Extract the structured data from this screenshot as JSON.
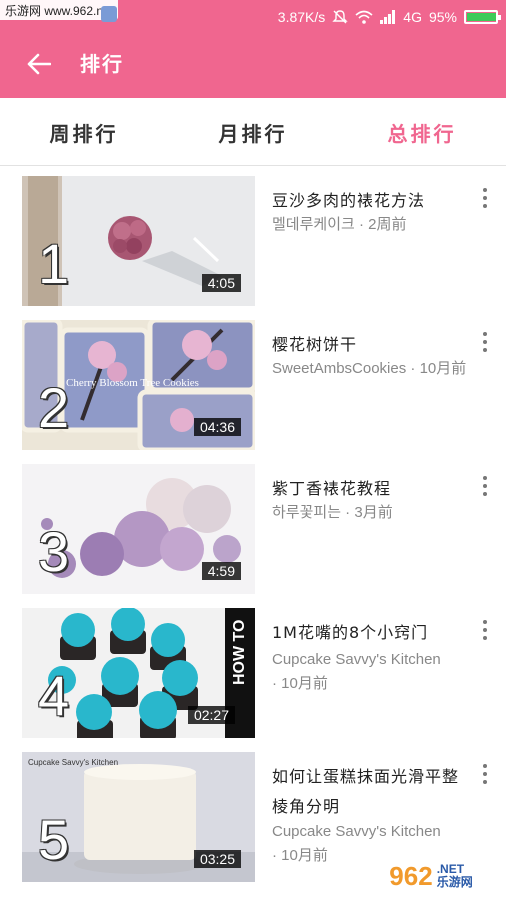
{
  "status_bar": {
    "watermark_text": "乐游网 www.962.net",
    "network_speed": "3.87K/s",
    "network_type": "4G",
    "battery_percent": "95%",
    "battery_level": 0.95
  },
  "header": {
    "title": "排行",
    "bg_color": "#f0668f"
  },
  "tabs": [
    {
      "label": "周排行",
      "active": false
    },
    {
      "label": "月排行",
      "active": false
    },
    {
      "label": "总排行",
      "active": true
    }
  ],
  "videos": [
    {
      "rank": "1",
      "duration": "4:05",
      "title": "豆沙多肉的裱花方法",
      "channel": "멜데루케이크",
      "time": "2周前"
    },
    {
      "rank": "2",
      "duration": "04:36",
      "overlay": "Cherry Blossom Tree Cookies",
      "title": "樱花树饼干",
      "channel": "SweetAmbsCookies",
      "time": "10月前"
    },
    {
      "rank": "3",
      "duration": "4:59",
      "title": "紫丁香裱花教程",
      "channel": "하루꽃피는",
      "time": "3月前"
    },
    {
      "rank": "4",
      "duration": "02:27",
      "overlay": "HOW TO",
      "title": "1M花嘴的8个小窍门",
      "channel": "Cupcake Savvy's Kitchen",
      "time": "10月前"
    },
    {
      "rank": "5",
      "duration": "03:25",
      "overlay": "Cupcake Savvy's Kitchen",
      "title": "如何让蛋糕抹面光滑平整棱角分明",
      "channel": "Cupcake Savvy's Kitchen",
      "time": "10月前"
    }
  ],
  "footer_watermark": {
    "big": "962",
    "small": ".NET",
    "sub": "乐游网"
  }
}
